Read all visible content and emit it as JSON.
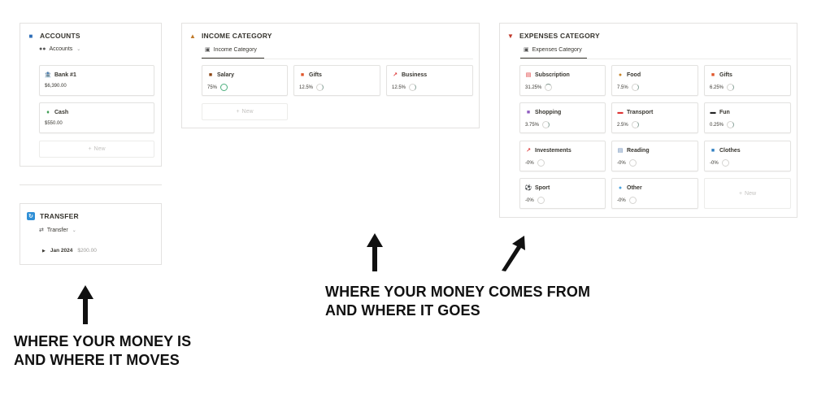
{
  "accounts": {
    "title": "ACCOUNTS",
    "icon": "bank-building-icon",
    "view_label": "Accounts",
    "items": [
      {
        "name": "Bank #1",
        "icon": "bank-icon",
        "value": "$6,390.00"
      },
      {
        "name": "Cash",
        "icon": "money-icon",
        "value": "$550.00"
      }
    ],
    "new_label": "New"
  },
  "transfer": {
    "title": "TRANSFER",
    "icon": "transfer-icon",
    "view_label": "Transfer",
    "group": {
      "label": "Jan 2024",
      "sum": "$200.00"
    }
  },
  "income": {
    "title": "INCOME CATEGORY",
    "icon": "income-icon",
    "view_label": "Income Category",
    "items": [
      {
        "name": "Salary",
        "icon": "briefcase-icon",
        "value": "75%",
        "progress": 0.75
      },
      {
        "name": "Gifts",
        "icon": "gift-icon",
        "value": "12.5%",
        "progress": 0.125
      },
      {
        "name": "Business",
        "icon": "chart-icon",
        "value": "12.5%",
        "progress": 0.125
      }
    ],
    "new_label": "New"
  },
  "expenses": {
    "title": "EXPENSES CATEGORY",
    "icon": "expenses-icon",
    "view_label": "Expenses Category",
    "items": [
      {
        "name": "Subscription",
        "icon": "calendar-icon",
        "value": "31.25%",
        "progress": 0.3125
      },
      {
        "name": "Food",
        "icon": "burger-icon",
        "value": "7.5%",
        "progress": 0.075
      },
      {
        "name": "Gifts",
        "icon": "gift-icon",
        "value": "6.25%",
        "progress": 0.0625
      },
      {
        "name": "Shopping",
        "icon": "shopping-bag-icon",
        "value": "3.75%",
        "progress": 0.0375
      },
      {
        "name": "Transport",
        "icon": "car-icon",
        "value": "2.5%",
        "progress": 0.025
      },
      {
        "name": "Fun",
        "icon": "gamepad-icon",
        "value": "0.25%",
        "progress": 0.0025
      },
      {
        "name": "Investements",
        "icon": "chart-icon",
        "value": "-0%",
        "progress": 0
      },
      {
        "name": "Reading",
        "icon": "newspaper-icon",
        "value": "-0%",
        "progress": 0
      },
      {
        "name": "Clothes",
        "icon": "shirt-icon",
        "value": "-0%",
        "progress": 0
      },
      {
        "name": "Sport",
        "icon": "soccer-ball-icon",
        "value": "-0%",
        "progress": 0
      },
      {
        "name": "Other",
        "icon": "speech-bubble-icon",
        "value": "-0%",
        "progress": 0
      }
    ],
    "new_label": "New"
  },
  "captions": {
    "left_line1": "WHERE YOUR MONEY IS",
    "left_line2": "AND WHERE IT MOVES",
    "right_line1": "WHERE YOUR MONEY COMES FROM",
    "right_line2": "AND WHERE IT GOES"
  }
}
